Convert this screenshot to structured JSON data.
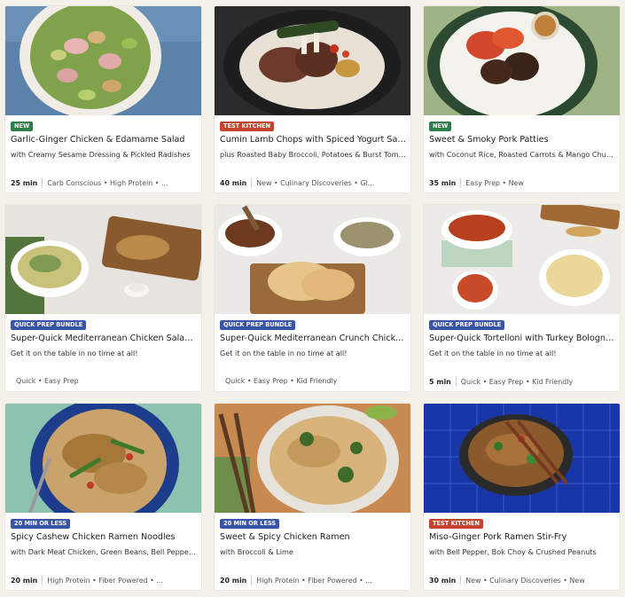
{
  "recipes": [
    {
      "badge": "NEW",
      "badge_color": "#2e7d4a",
      "title": "Garlic-Ginger Chicken & Edamame Salad",
      "subtitle": "with Creamy Sesame Dressing & Pickled Radishes",
      "time": "25 min",
      "tags": "Carb Conscious • High Protein • ...",
      "image": "salad-bowl"
    },
    {
      "badge": "TEST KITCHEN",
      "badge_color": "#c4432c",
      "title": "Cumin Lamb Chops with Spiced Yogurt Sau...",
      "subtitle": "plus Roasted Baby Broccoli, Potatoes & Burst Tomat...",
      "time": "40 min",
      "tags": "New • Culinary Discoveries • Gl...",
      "image": "lamb-plate"
    },
    {
      "badge": "NEW",
      "badge_color": "#2e7d4a",
      "title": "Sweet & Smoky Pork Patties",
      "subtitle": "with Coconut Rice, Roasted Carrots & Mango Chutney",
      "time": "35 min",
      "tags": "Easy Prep • New",
      "image": "pork-bowl"
    },
    {
      "badge": "QUICK PREP BUNDLE",
      "badge_color": "#3a55a8",
      "title": "Super-Quick Mediterranean Chicken Salad ...",
      "subtitle": "Get it on the table in no time at all!",
      "time": "",
      "tags": "Quick • Easy Prep",
      "image": "chicken-board"
    },
    {
      "badge": "QUICK PREP BUNDLE",
      "badge_color": "#3a55a8",
      "title": "Super-Quick Mediterranean Crunch Chicke...",
      "subtitle": "Get it on the table in no time at all!",
      "time": "",
      "tags": "Quick • Easy Prep • Kid Friendly",
      "image": "pita-spread"
    },
    {
      "badge": "QUICK PREP BUNDLE",
      "badge_color": "#3a55a8",
      "title": "Super-Quick Tortelloni with Turkey Bolognes...",
      "subtitle": "Get it on the table in no time at all!",
      "time": "5 min",
      "tags": "Quick • Easy Prep • Kid Friendly",
      "image": "tortelloni-spread"
    },
    {
      "badge": "20 MIN OR LESS",
      "badge_color": "#3a55a8",
      "title": "Spicy Cashew Chicken Ramen Noodles",
      "subtitle": "with Dark Meat Chicken, Green Beans, Bell Pepper ...",
      "time": "20 min",
      "tags": "High Protein • Fiber Powered • ...",
      "image": "ramen-blue-plate"
    },
    {
      "badge": "20 MIN OR LESS",
      "badge_color": "#3a55a8",
      "title": "Sweet & Spicy Chicken Ramen",
      "subtitle": "with Broccoli & Lime",
      "time": "20 min",
      "tags": "High Protein • Fiber Powered • ...",
      "image": "ramen-wood-bowl"
    },
    {
      "badge": "TEST KITCHEN",
      "badge_color": "#c4432c",
      "title": "Miso-Ginger Pork Ramen Stir-Fry",
      "subtitle": "with Bell Pepper, Bok Choy & Crushed Peanuts",
      "time": "30 min",
      "tags": "New • Culinary Discoveries • New",
      "image": "ramen-blue-tiles"
    }
  ]
}
